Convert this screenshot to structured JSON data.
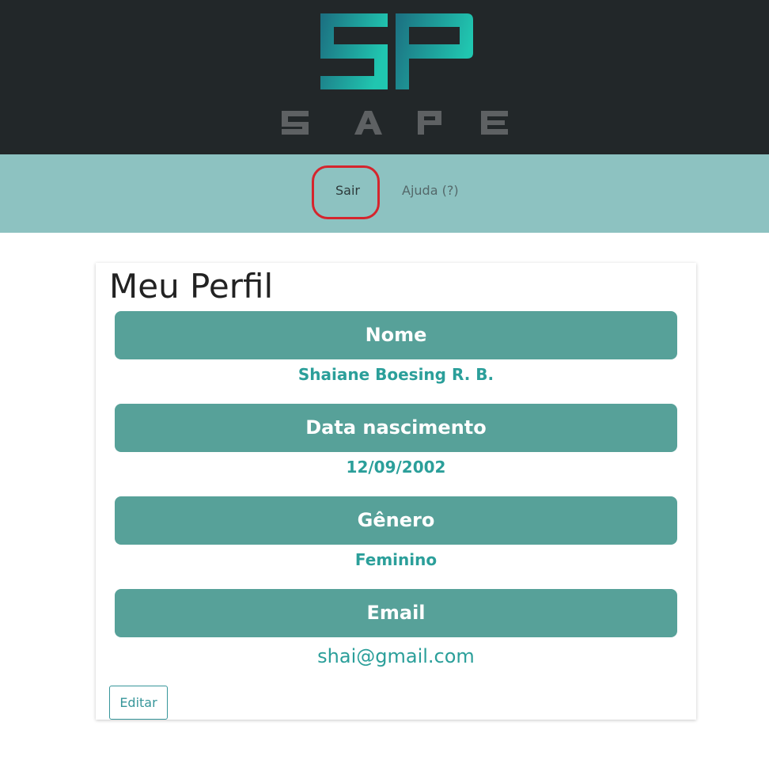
{
  "brand": {
    "logo_text": "SAPE",
    "logo_colors": {
      "gradient_start": "#1c6e80",
      "gradient_end": "#20c6b0",
      "text": "#5e6163"
    }
  },
  "nav": {
    "items": [
      {
        "label": "Sair"
      },
      {
        "label": "Ajuda (?)"
      }
    ]
  },
  "profile": {
    "title": "Meu Perfil",
    "fields": [
      {
        "label": "Nome",
        "value": "Shaiane Boesing R. B."
      },
      {
        "label": "Data nascimento",
        "value": "12/09/2002"
      },
      {
        "label": "Gênero",
        "value": "Feminino"
      },
      {
        "label": "Email",
        "value": "shai@gmail.com"
      }
    ],
    "edit_label": "Editar"
  },
  "colors": {
    "header_bg": "#222729",
    "nav_bg": "#8dc2c1",
    "field_header_bg": "#57a199",
    "value_text": "#2b9f9a",
    "highlight": "#d5252d"
  }
}
